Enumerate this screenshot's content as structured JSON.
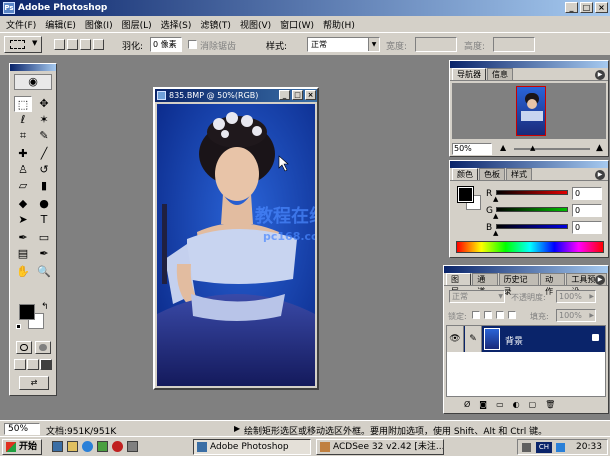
{
  "window": {
    "title": "Adobe Photoshop",
    "app_icon": "photoshop-icon",
    "controls": {
      "minimize": "_",
      "maximize": "□",
      "close": "×"
    }
  },
  "menubar": {
    "items": [
      "文件(F)",
      "编辑(E)",
      "图像(I)",
      "图层(L)",
      "选择(S)",
      "滤镜(T)",
      "视图(V)",
      "窗口(W)",
      "帮助(H)"
    ]
  },
  "options_bar": {
    "feather_label": "羽化:",
    "feather_value": "0 像素",
    "antialias_label": "消除锯齿",
    "style_label": "样式:",
    "style_value": "正常",
    "width_label": "宽度:",
    "height_label": "高度:"
  },
  "toolbox": {
    "icons": [
      "marquee-icon",
      "move-icon",
      "lasso-icon",
      "magic-wand-icon",
      "crop-icon",
      "slice-icon",
      "healing-brush-icon",
      "brush-icon",
      "clone-stamp-icon",
      "history-brush-icon",
      "eraser-icon",
      "gradient-icon",
      "blur-icon",
      "dodge-icon",
      "path-selection-icon",
      "type-icon",
      "pen-icon",
      "rectangle-shape-icon",
      "notes-icon",
      "eyedropper-icon",
      "hand-icon",
      "zoom-icon"
    ],
    "glyphs": [
      "⬚",
      "✥",
      "ℓ",
      "✶",
      "⌗",
      "✎",
      "✚",
      "╱",
      "♙",
      "↺",
      "▱",
      "▮",
      "◆",
      "●",
      "➤",
      "T",
      "✒",
      "▭",
      "▤",
      "✒",
      "✋",
      "🔍"
    ]
  },
  "document": {
    "title": "835.BMP @ 50%(RGB)",
    "watermark": "教程在线",
    "watermark_sub": "pc168.com"
  },
  "navigator_panel": {
    "tabs": [
      "导航器",
      "信息"
    ],
    "zoom": "50%"
  },
  "color_panel": {
    "tabs": [
      "颜色",
      "色板",
      "样式"
    ],
    "channels": [
      {
        "label": "R",
        "value": "0",
        "color": "#c00000"
      },
      {
        "label": "G",
        "value": "0",
        "color": "#00a000"
      },
      {
        "label": "B",
        "value": "0",
        "color": "#0000c0"
      }
    ]
  },
  "layers_panel": {
    "tabs": [
      "图层",
      "通道",
      "历史记录",
      "动作",
      "工具预设"
    ],
    "blend_mode": "正常",
    "opacity_label": "不透明度:",
    "opacity_value": "100%",
    "lock_label": "锁定:",
    "fill_label": "填充:",
    "fill_value": "100%",
    "layer_name": "背景"
  },
  "status_bar": {
    "zoom": "50%",
    "doc_info": "文档:951K/951K",
    "hint": "绘制矩形选区或移动选区外框。要用附加选项，使用 Shift、Alt 和 Ctrl 键。"
  },
  "taskbar": {
    "start_label": "开始",
    "buttons": [
      "Adobe Photoshop",
      "ACDSee 32 v2.42 [未注..."
    ],
    "clock": "20:33",
    "ime": "CH"
  },
  "colors": {
    "title_gradient_start": "#0a246a",
    "title_gradient_end": "#a6caf0",
    "chrome": "#d4d0c8",
    "workspace": "#808080",
    "layer_selected": "#0a246a"
  }
}
